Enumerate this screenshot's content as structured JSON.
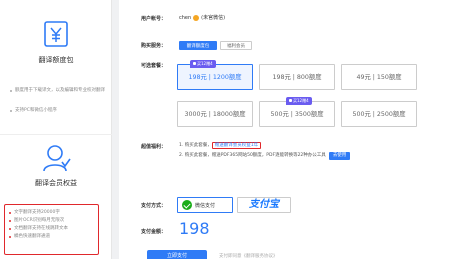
{
  "sidebar": {
    "package": {
      "title": "翻译额度包",
      "features": [
        "额度用于下载译文，以及编辑和专业校对翻译",
        "支持PC和微信小程序"
      ]
    },
    "member": {
      "title": "翻译会员权益",
      "benefits": [
        "文字翻译支持20000字",
        "图片OCR识别每月无限次",
        "文档翻译支持在线跳转文本",
        "橘色快速翻译通道"
      ]
    }
  },
  "main": {
    "account": {
      "label": "用户帐号：",
      "value": "chen",
      "suffix": "(未官微信)"
    },
    "package_type": {
      "label": "购买服务：",
      "tabs": [
        {
          "label": "翻译额度包",
          "active": true
        },
        {
          "label": "福利会员",
          "active": false
        }
      ]
    },
    "options": {
      "label": "可选套餐：",
      "items": [
        {
          "text": "198元 | 1200额度",
          "active": true,
          "badge": "买12赠4"
        },
        {
          "text": "198元 | 800额度",
          "active": false,
          "badge": ""
        },
        {
          "text": "49元 | 150额度",
          "active": false,
          "badge": ""
        },
        {
          "text": "3000元 | 18000额度",
          "active": false,
          "badge": ""
        },
        {
          "text": "500元 | 3500额度",
          "active": false,
          "badge": "买12赠4"
        },
        {
          "text": "500元 | 2500额度",
          "active": false,
          "badge": ""
        }
      ]
    },
    "gift": {
      "label": "超值福利：",
      "line1_prefix": "1. 购买此套餐，",
      "line1_highlight": "赠送翻译会员权益1年",
      "line2": "2. 购买此套餐，赠送PDF365网站50额度，PDF逐能转换等22种办公工具",
      "use_button": "去使用"
    },
    "payment": {
      "label": "支付方式：",
      "wechat": "微信支付",
      "alipay": "支付宝"
    },
    "amount": {
      "label": "支付金额：",
      "value": "198"
    },
    "pay_button": "立即支付",
    "bottom_hint": "支付即同意《翻译服务协议》"
  },
  "colors": {
    "accent": "#2f7bf6",
    "highlight_border": "#e0282c",
    "badge": "#6a5cf0",
    "wechat": "#1aad19"
  }
}
